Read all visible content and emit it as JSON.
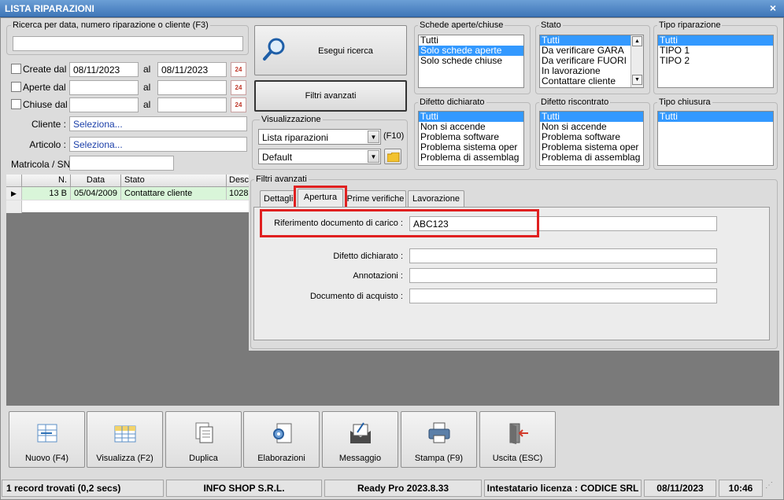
{
  "window": {
    "title": "LISTA RIPARAZIONI",
    "close_symbol": "×"
  },
  "search": {
    "legend": "Ricerca per data, numero riparazione o cliente (F3)",
    "value": "",
    "created": {
      "label": "Create dal",
      "from": "08/11/2023",
      "al": "al",
      "to": "08/11/2023"
    },
    "opened": {
      "label": "Aperte dal",
      "from": "",
      "al": "al",
      "to": ""
    },
    "closed": {
      "label": "Chiuse dal",
      "from": "",
      "al": "al",
      "to": ""
    },
    "calendar_text": "24",
    "cliente_label": "Cliente :",
    "cliente_value": "Seleziona...",
    "articolo_label": "Articolo :",
    "articolo_value": "Seleziona...",
    "matricola_label": "Matricola / SN:",
    "matricola_value": ""
  },
  "buttons": {
    "search": "Esegui ricerca",
    "advanced": "Filtri avanzati"
  },
  "view": {
    "legend": "Visualizzazione",
    "list": "Lista riparazioni",
    "f10": "(F10)",
    "layout": "Default"
  },
  "filters": {
    "schede": {
      "legend": "Schede aperte/chiuse",
      "items": [
        "Tutti",
        "Solo schede aperte",
        "Solo schede chiuse"
      ],
      "selected": 1
    },
    "stato": {
      "legend": "Stato",
      "items": [
        "Tutti",
        "Da verificare GARA",
        "Da verificare FUORI",
        "In lavorazione",
        "Contattare cliente"
      ],
      "selected": 0
    },
    "tipo_rip": {
      "legend": "Tipo riparazione",
      "items": [
        "Tutti",
        "TIPO 1",
        "TIPO 2"
      ],
      "selected": 0
    },
    "difetto_dich": {
      "legend": "Difetto dichiarato",
      "items": [
        "Tutti",
        "Non si accende",
        "Problema software",
        "Problema sistema oper",
        "Problema di assemblag"
      ],
      "selected": 0
    },
    "difetto_risc": {
      "legend": "Difetto riscontrato",
      "items": [
        "Tutti",
        "Non si accende",
        "Problema software",
        "Problema sistema oper",
        "Problema di assemblag"
      ],
      "selected": 0
    },
    "tipo_chiusura": {
      "legend": "Tipo chiusura",
      "items": [
        "Tutti"
      ],
      "selected": 0
    }
  },
  "grid": {
    "headers": [
      "N.",
      "Data",
      "Stato",
      "Desc"
    ],
    "rows": [
      {
        "n": "13 B",
        "data": "05/04/2009",
        "stato": "Contattare cliente",
        "desc": "1028"
      }
    ]
  },
  "advanced": {
    "legend": "Filtri avanzati",
    "tabs": [
      "Dettagli",
      "Apertura",
      "Prime verifiche",
      "Lavorazione"
    ],
    "active_tab": 1,
    "fields": [
      {
        "label": "Riferimento documento di carico :",
        "value": "ABC123"
      },
      {
        "label": "Difetto dichiarato :",
        "value": ""
      },
      {
        "label": "Annotazioni :",
        "value": ""
      },
      {
        "label": "Documento di acquisto :",
        "value": ""
      }
    ]
  },
  "toolbar": [
    {
      "label": "Nuovo (F4)",
      "icon": "new-grid-icon"
    },
    {
      "label": "Visualizza (F2)",
      "icon": "view-grid-icon"
    },
    {
      "label": "Duplica",
      "icon": "duplicate-icon"
    },
    {
      "label": "Elaborazioni",
      "icon": "process-gear-icon"
    },
    {
      "label": "Messaggio",
      "icon": "message-icon"
    },
    {
      "label": "Stampa (F9)",
      "icon": "printer-icon"
    },
    {
      "label": "Uscita (ESC)",
      "icon": "exit-door-icon"
    }
  ],
  "status": {
    "records": "1 record trovati (0,2 secs)",
    "company": "INFO SHOP S.R.L.",
    "version": "Ready Pro 2023.8.33",
    "license": "Intestatario licenza : CODICE SRL",
    "date": "08/11/2023",
    "time": "10:46"
  },
  "colors": {
    "selection": "#3399ff",
    "grid_row": "#d9f5d9",
    "highlight": "#e02020",
    "title": "#3f76b8"
  }
}
